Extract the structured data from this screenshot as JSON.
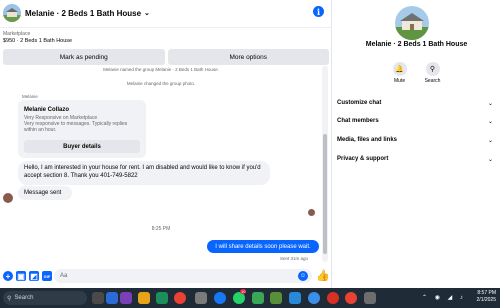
{
  "chat": {
    "title": "Melanie · 2 Beds 1 Bath House",
    "title_chevron": "⌄",
    "info_icon": "i",
    "listing": {
      "label": "Marketplace",
      "price_title": "$950 · 2 Beds 1 Bath House"
    },
    "actions": {
      "mark_pending": "Mark as pending",
      "more_options": "More options"
    },
    "system_messages": [
      "Melanie named the group Melanie · 2 Beds 1 Bath House.",
      "Melanie changed the group photo."
    ],
    "card": {
      "sender": "Melanie",
      "name": "Melanie Collazo",
      "desc_line1": "Very Responsive on Marketplace",
      "desc_line2": "Very responsive to messages. Typically replies within an hour.",
      "button": "Buyer details"
    },
    "messages": {
      "incoming_1": "Hello, I am interested in your house for rent. I am disabled and would like to know if you'd accept section 8. Thank you 401-749-5822",
      "incoming_2": "Message sent",
      "time_divider": "8:25 PM",
      "outgoing_1": "I will share details soon please wait.",
      "sent_status": "Sent 31m ago"
    },
    "composer": {
      "placeholder": "Aa"
    }
  },
  "info_panel": {
    "title": "Melanie · 2 Beds 1 Bath House",
    "actions": [
      {
        "label": "Mute",
        "icon": "bell-icon"
      },
      {
        "label": "Search",
        "icon": "search-icon"
      }
    ],
    "sections": [
      "Customize chat",
      "Chat members",
      "Media, files and links",
      "Privacy & support"
    ]
  },
  "taskbar": {
    "search_placeholder": "Search",
    "time": "8:57 PM",
    "date": "2/1/2025",
    "badge": "10"
  },
  "colors": {
    "accent": "#0866ff",
    "bubble_in": "#f0f2f5",
    "taskbar": "#1f2b36"
  }
}
